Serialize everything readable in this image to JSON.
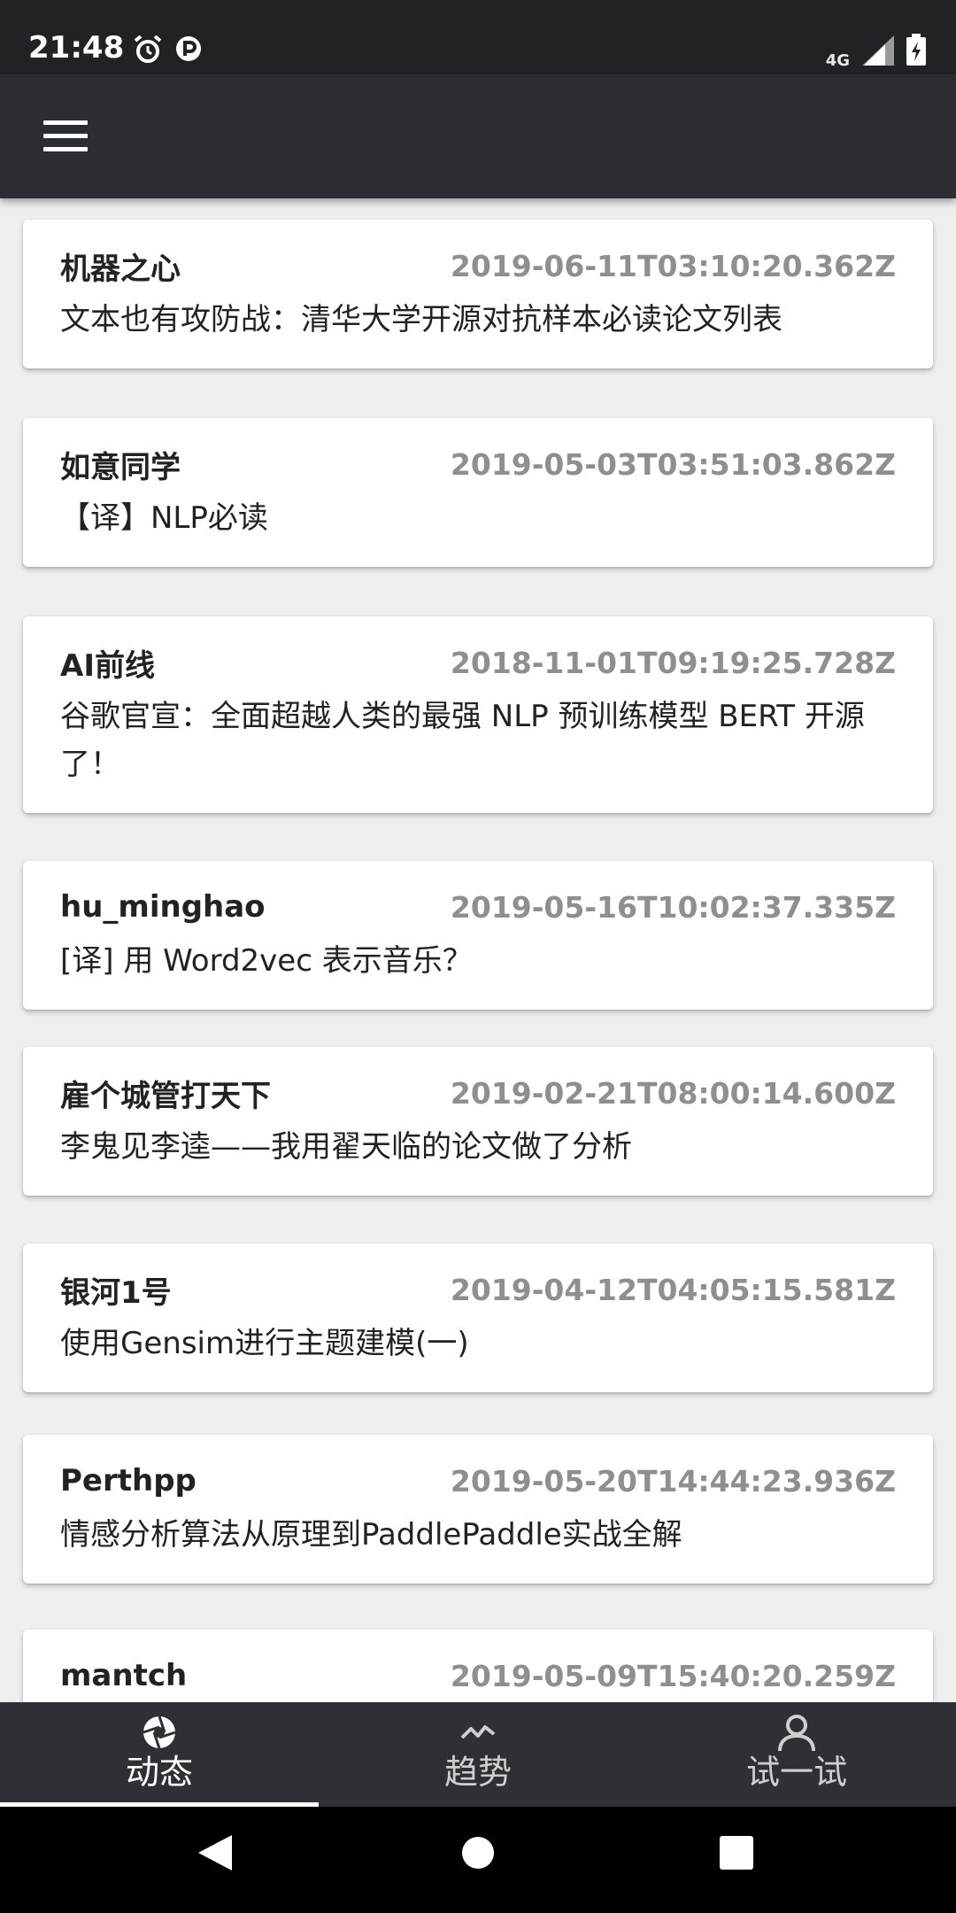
{
  "status_bar": {
    "time": "21:48",
    "network": "4G",
    "icons": [
      "alarm-icon",
      "p-app-icon",
      "signal-icon",
      "battery-charging-icon"
    ]
  },
  "app_bar": {
    "menu_icon": "hamburger-menu-icon"
  },
  "feed": [
    {
      "author": "机器之心",
      "time": "2019-06-11T03:10:20.362Z",
      "title": "文本也有攻防战：清华大学开源对抗样本必读论文列表"
    },
    {
      "author": "如意同学",
      "time": "2019-05-03T03:51:03.862Z",
      "title": "【译】NLP必读"
    },
    {
      "author": "AI前线",
      "time": "2018-11-01T09:19:25.728Z",
      "title": "谷歌官宣：全面超越人类的最强 NLP 预训练模型 BERT 开源了！"
    },
    {
      "author": "hu_minghao",
      "time": "2019-05-16T10:02:37.335Z",
      "title": "[译] 用 Word2vec 表示音乐？"
    },
    {
      "author": "雇个城管打天下",
      "time": "2019-02-21T08:00:14.600Z",
      "title": "李鬼见李逵——我用翟天临的论文做了分析"
    },
    {
      "author": "银河1号",
      "time": "2019-04-12T04:05:15.581Z",
      "title": "使用Gensim进行主题建模(一)"
    },
    {
      "author": "Perthpp",
      "time": "2019-05-20T14:44:23.936Z",
      "title": "情感分析算法从原理到PaddlePaddle实战全解"
    },
    {
      "author": "mantch",
      "time": "2019-05-09T15:40:20.259Z",
      "title": ""
    }
  ],
  "bottom_nav": [
    {
      "label": "动态",
      "icon": "aperture-icon",
      "active": true
    },
    {
      "label": "趋势",
      "icon": "trend-icon",
      "active": false
    },
    {
      "label": "试一试",
      "icon": "person-icon",
      "active": false
    }
  ],
  "system_nav": [
    "back-icon",
    "home-icon",
    "recents-icon"
  ],
  "colors": {
    "status_bar": "#202326",
    "app_bar": "#2a2d31",
    "background": "#efefef",
    "bottom_nav": "#2d3034",
    "timestamp": "#8f8f8f"
  }
}
